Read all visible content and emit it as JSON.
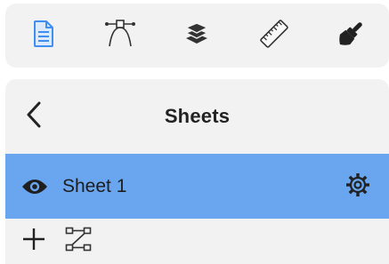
{
  "toolbar": {
    "items": [
      {
        "name": "document-icon",
        "color": "#3f8ef0"
      },
      {
        "name": "bezier-pen-icon",
        "color": "#333333"
      },
      {
        "name": "layers-icon",
        "color": "#333333"
      },
      {
        "name": "ruler-icon",
        "color": "#333333"
      },
      {
        "name": "paint-brush-icon",
        "color": "#222222"
      }
    ]
  },
  "panel": {
    "title": "Sheets",
    "back_icon": "chevron-left-icon"
  },
  "sheets": [
    {
      "name": "Sheet 1",
      "visible": true,
      "selected": true,
      "settings_icon": "gear-icon"
    }
  ],
  "footer": {
    "add_icon": "plus-icon",
    "transform_icon": "bezier-transform-icon"
  },
  "colors": {
    "selection": "#6aa6ef",
    "panel_background": "#f2f2f2",
    "accent": "#3f8ef0"
  }
}
